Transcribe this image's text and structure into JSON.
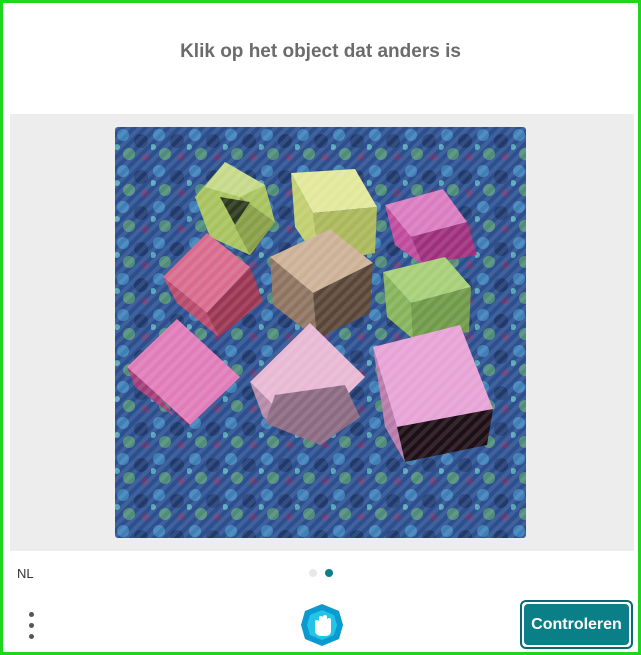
{
  "header": {
    "title": "Klik op het object dat anders is"
  },
  "challenge": {
    "image_icon": "cubes-challenge-image",
    "cube_colors": [
      "#a8c35e",
      "#cdd873",
      "#c04a9c",
      "#cf5b80",
      "#a48a74",
      "#92bc5e",
      "#d06aa8",
      "#c79aba",
      "#d98bc8"
    ]
  },
  "footer": {
    "language": "NL",
    "pagination": {
      "total": 2,
      "current": 2
    },
    "menu_icon": "more-vertical-icon",
    "logo_icon": "hand-logo-icon",
    "submit_label": "Controleren"
  },
  "colors": {
    "border": "#1fd61f",
    "accent": "#0a7f87",
    "dot_inactive": "#e8e8e8",
    "title_text": "#6b6b6b"
  }
}
